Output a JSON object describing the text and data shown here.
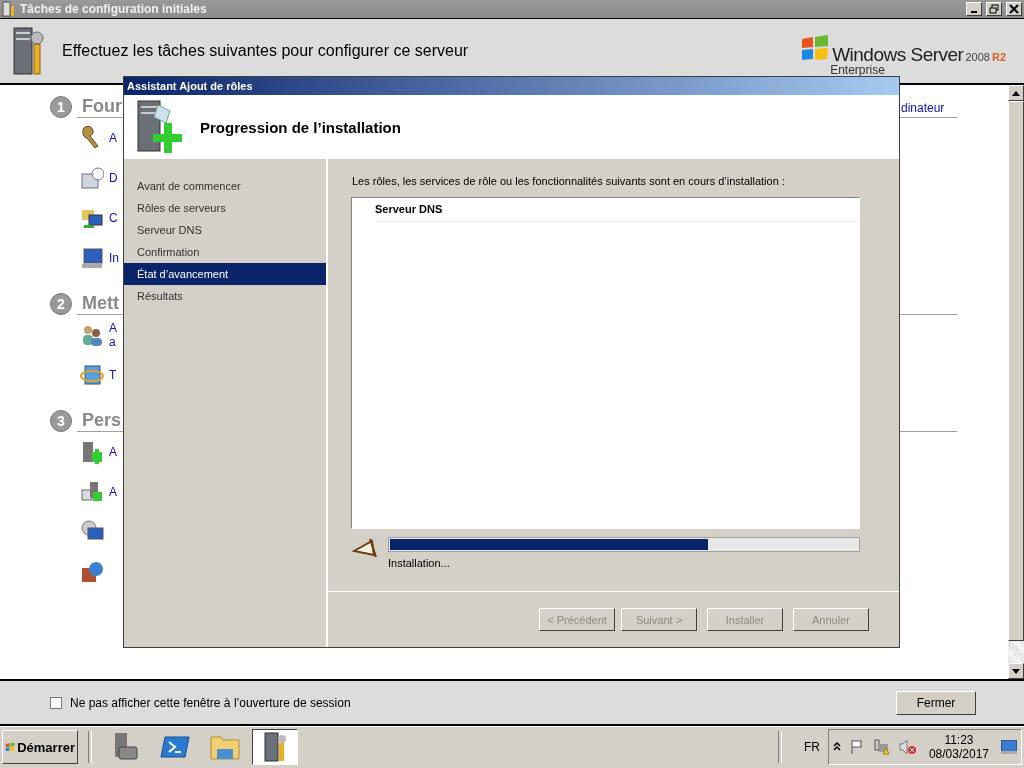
{
  "window": {
    "title": "Tâches de configuration initiales"
  },
  "header": {
    "heading": "Effectuez les tâches suivantes pour configurer ce serveur",
    "logo": {
      "product": "Windows Server",
      "version": "2008",
      "release": "R2",
      "edition": "Enterprise"
    }
  },
  "sections": [
    {
      "number": "1",
      "title": "Four",
      "right_link": "dinateur",
      "items": [
        {
          "kind": "link",
          "lines": [
            "A"
          ]
        },
        {
          "kind": "link",
          "lines": [
            "D"
          ]
        },
        {
          "kind": "link",
          "lines": [
            "C"
          ]
        },
        {
          "kind": "link",
          "lines": [
            "In"
          ]
        }
      ]
    },
    {
      "number": "2",
      "title": "Mett",
      "items": [
        {
          "kind": "link",
          "lines": [
            "A",
            "a"
          ]
        },
        {
          "kind": "link",
          "lines": [
            "T"
          ]
        }
      ]
    },
    {
      "number": "3",
      "title": "Pers",
      "items": [
        {
          "kind": "link",
          "lines": [
            "A"
          ]
        },
        {
          "kind": "link",
          "lines": [
            "A"
          ]
        },
        {
          "kind": "icon-only"
        },
        {
          "kind": "icon-only"
        }
      ]
    }
  ],
  "dialog": {
    "title": "Assistant Ajout de rôles",
    "heading": "Progression de l’installation",
    "steps": [
      {
        "label": "Avant de commencer",
        "selected": false
      },
      {
        "label": "Rôles de serveurs",
        "selected": false
      },
      {
        "label": "Serveur DNS",
        "selected": false
      },
      {
        "label": "Confirmation",
        "selected": false
      },
      {
        "label": "État d’avancement",
        "selected": true
      },
      {
        "label": "Résultats",
        "selected": false
      }
    ],
    "description": "Les rôles, les services de rôle ou les fonctionnalités suivants sont en cours d’installation :",
    "list_items": [
      "Serveur DNS"
    ],
    "progress": {
      "level": 0.68,
      "status": "Installation..."
    },
    "buttons": [
      {
        "label": "< Précédent",
        "disabled": true
      },
      {
        "label": "Suivant >",
        "disabled": true
      },
      {
        "label": "Installer",
        "disabled": true
      },
      {
        "label": "Annuler",
        "disabled": true
      }
    ]
  },
  "footer": {
    "checkbox": {
      "label": "Ne pas afficher cette fenêtre à l’ouverture de session",
      "checked": false
    },
    "close_button": "Fermer"
  },
  "taskbar": {
    "start": "Démarrer",
    "apps": [
      {
        "selected": false
      },
      {
        "selected": false
      },
      {
        "selected": false
      },
      {
        "selected": true
      }
    ],
    "language": "FR",
    "clock": {
      "time": "11:23",
      "date": "08/03/2017"
    }
  }
}
